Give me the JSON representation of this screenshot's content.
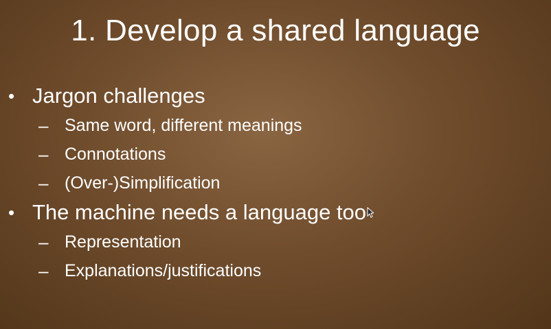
{
  "slide": {
    "title": "1. Develop a shared language",
    "bullet_marker": "•",
    "dash_marker": "–",
    "bullets": [
      {
        "text": "Jargon challenges",
        "subs": [
          "Same word, different meanings",
          "Connotations",
          "(Over-)Simplification"
        ]
      },
      {
        "text": "The machine needs a language too",
        "subs": [
          "Representation",
          "Explanations/justifications"
        ]
      }
    ]
  },
  "icons": {
    "cursor": "mouse-pointer-icon"
  },
  "colors": {
    "background_center": "#8a6542",
    "background_edge": "#523519",
    "text": "#ffffff"
  }
}
